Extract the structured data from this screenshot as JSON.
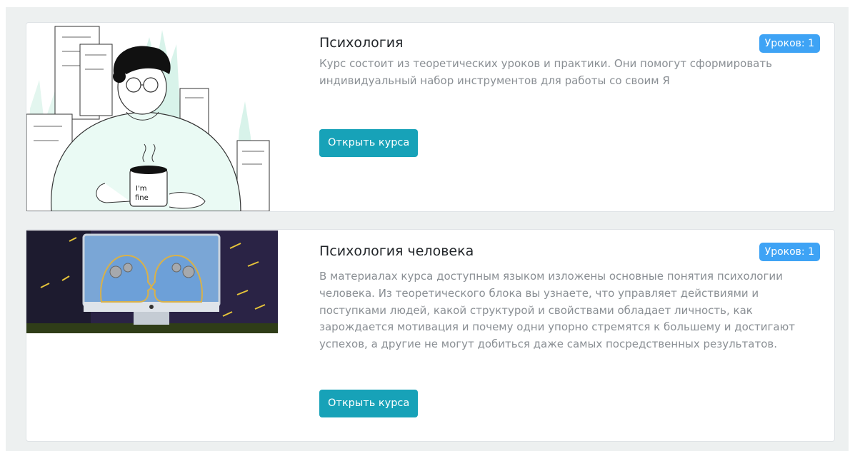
{
  "courses": [
    {
      "title": "Психология",
      "badge": "Уроков: 1",
      "description": "Курс состоит из теоретических уроков и практики. Они помогут сформировать индивидуальный набор инструментов для работы со своим Я",
      "button_label": "Открыть курса",
      "image": {
        "caption_line1": "I'm",
        "caption_line2": "fine"
      }
    },
    {
      "title": "Психология человека",
      "badge": "Уроков: 1",
      "description": "В материалах курса доступным языком изложены основные понятия психологии человека. Из теоретического блока вы узнаете, что управляет действиями и поступками людей, какой структурой и свойствами обладает личность, как зарождается мотивация и почему одни упорно стремятся к большему и достигают успехов, а другие не могут добиться даже самых посредственных результатов.",
      "button_label": "Открыть курса"
    }
  ],
  "colors": {
    "badge": "#3ea3f5",
    "button": "#17a2b8",
    "page_bg": "#edf0f0"
  }
}
